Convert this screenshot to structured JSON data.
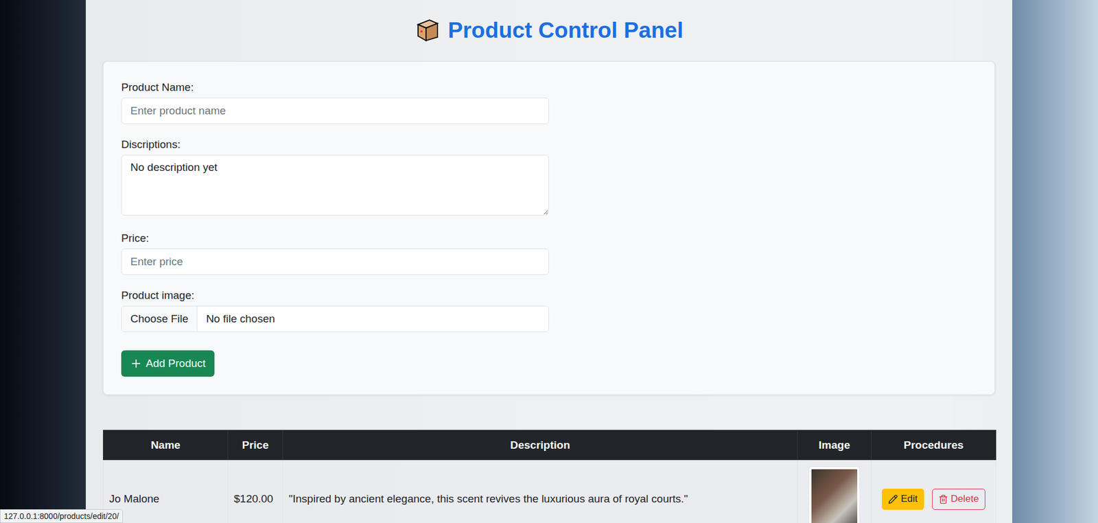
{
  "header": {
    "title": "Product Control Panel"
  },
  "form": {
    "fields": [
      {
        "kind": "text",
        "label": "Product Name:",
        "placeholder": "Enter product name"
      },
      {
        "kind": "textarea",
        "label": "Discriptions:",
        "value": "No description yet"
      },
      {
        "kind": "text",
        "label": "Price:",
        "placeholder": "Enter price"
      },
      {
        "kind": "file",
        "label": "Product image:",
        "button": "Choose File",
        "status": "No file chosen"
      }
    ],
    "submit": "Add Product"
  },
  "table": {
    "columns": [
      "Name",
      "Price",
      "Description",
      "Image",
      "Procedures"
    ],
    "rows": [
      {
        "name": "Jo Malone",
        "price": "$120.00",
        "description": "\"Inspired by ancient elegance, this scent revives the luxurious aura of royal courts.\"",
        "edit": "Edit",
        "delete": "Delete"
      }
    ]
  },
  "status_bar": "127.0.0.1:8000/products/edit/20/"
}
